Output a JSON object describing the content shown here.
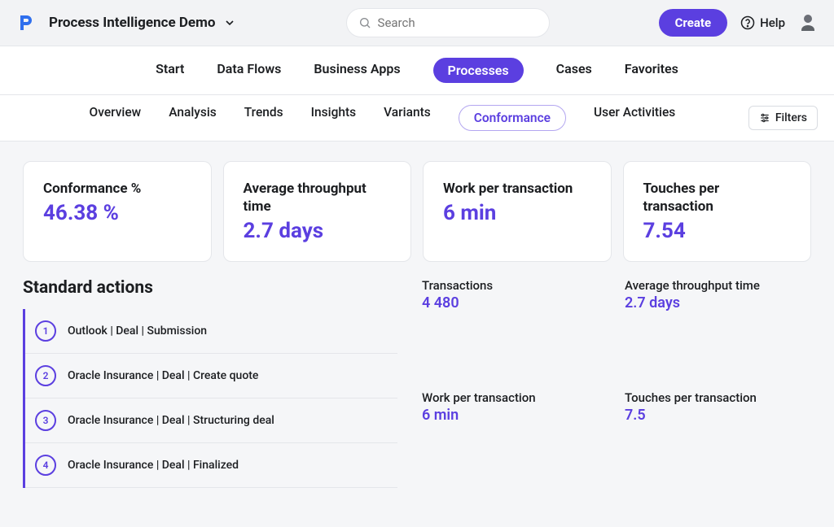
{
  "header": {
    "workspace_name": "Process Intelligence Demo",
    "search_placeholder": "Search",
    "create_label": "Create",
    "help_label": "Help"
  },
  "nav": {
    "items": [
      {
        "label": "Start"
      },
      {
        "label": "Data Flows"
      },
      {
        "label": "Business Apps"
      },
      {
        "label": "Processes",
        "active": true
      },
      {
        "label": "Cases"
      },
      {
        "label": "Favorites"
      }
    ]
  },
  "subnav": {
    "items": [
      {
        "label": "Overview"
      },
      {
        "label": "Analysis"
      },
      {
        "label": "Trends"
      },
      {
        "label": "Insights"
      },
      {
        "label": "Variants"
      },
      {
        "label": "Conformance",
        "active": true
      },
      {
        "label": "User Activities"
      }
    ],
    "filters_label": "Filters"
  },
  "kpis": [
    {
      "label": "Conformance %",
      "value": "46.38 %"
    },
    {
      "label": "Average throughput time",
      "value": "2.7 days"
    },
    {
      "label": "Work per transaction",
      "value": "6 min"
    },
    {
      "label": "Touches per transaction",
      "value": "7.54"
    }
  ],
  "standard_actions": {
    "title": "Standard actions",
    "items": [
      {
        "num": "1",
        "label": "Outlook | Deal | Submission"
      },
      {
        "num": "2",
        "label": "Oracle Insurance | Deal | Create quote"
      },
      {
        "num": "3",
        "label": "Oracle Insurance | Deal | Structuring deal"
      },
      {
        "num": "4",
        "label": "Oracle Insurance | Deal | Finalized"
      }
    ]
  },
  "right_stats": [
    {
      "label": "Transactions",
      "value": "4 480"
    },
    {
      "label": "Average throughput time",
      "value": "2.7 days"
    },
    {
      "label": "Work per transaction",
      "value": "6 min"
    },
    {
      "label": "Touches per transaction",
      "value": "7.5"
    }
  ]
}
